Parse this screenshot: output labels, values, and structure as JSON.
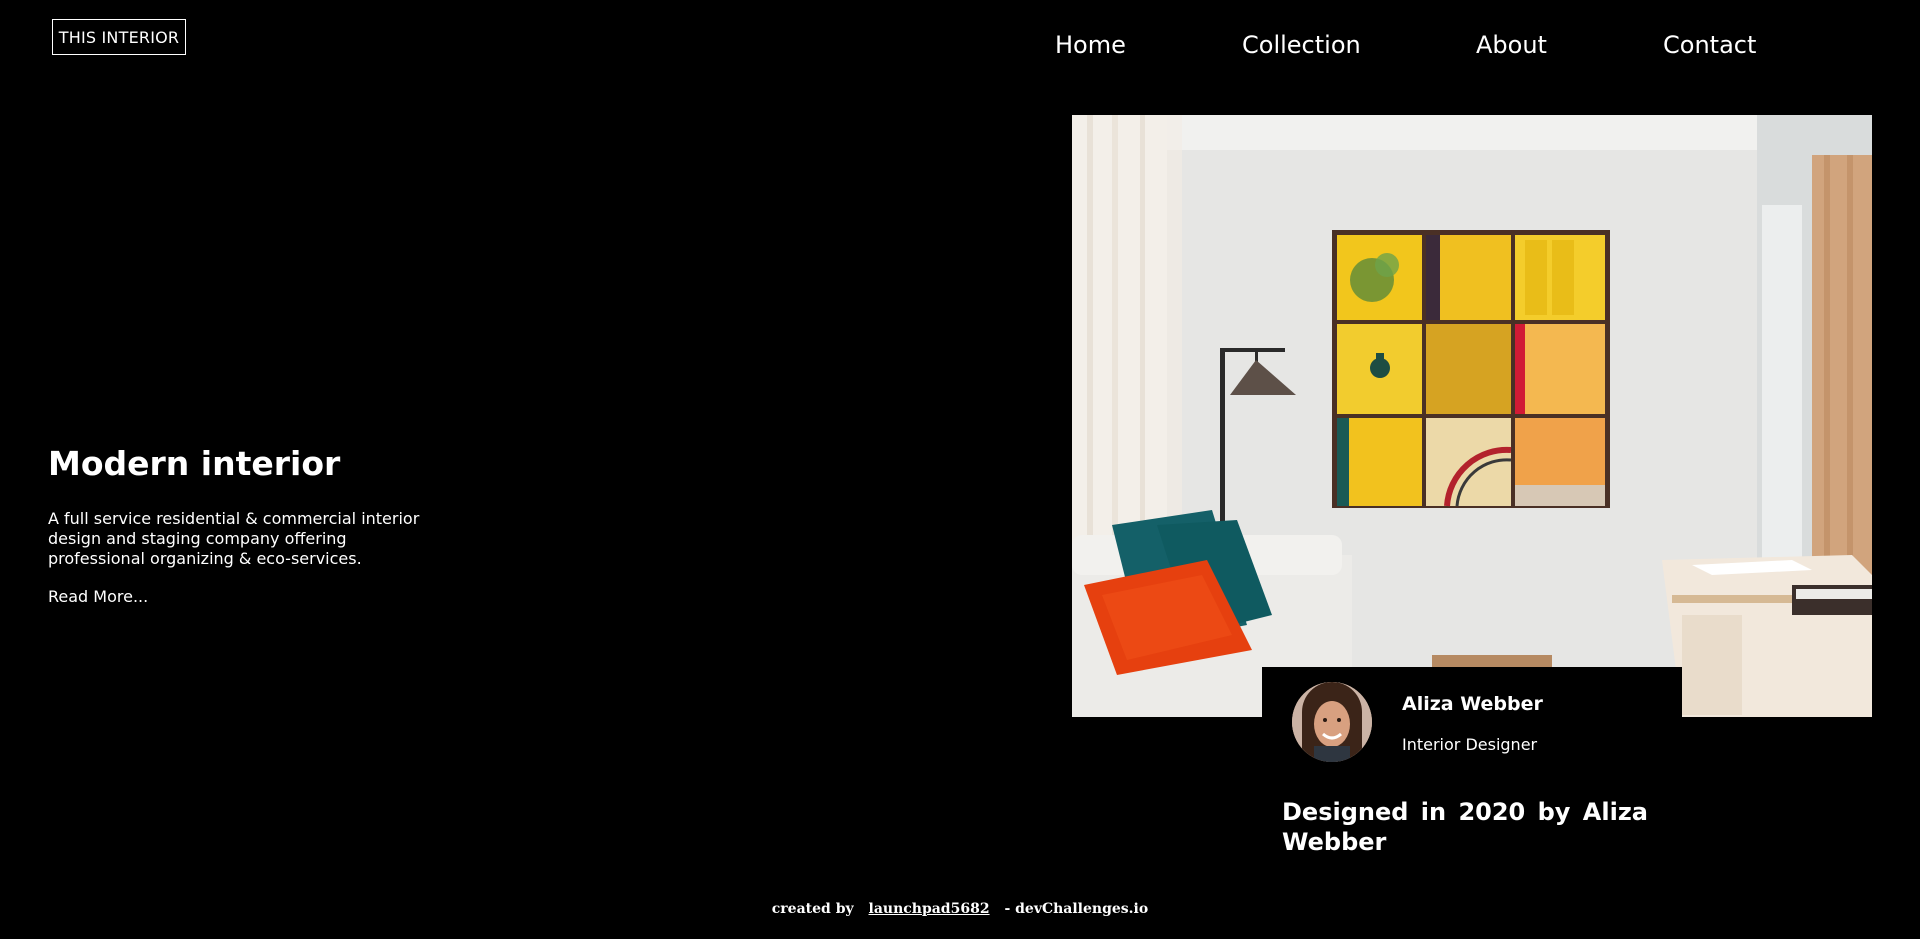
{
  "header": {
    "logo_text": "THIS INTERIOR",
    "nav": [
      {
        "label": "Home"
      },
      {
        "label": "Collection"
      },
      {
        "label": "About"
      },
      {
        "label": "Contact"
      }
    ]
  },
  "hero": {
    "title": "Modern interior",
    "description": "A full service residential & commercial interior design and staging company offering professional organizing & eco-services.",
    "read_more": "Read More..."
  },
  "designer": {
    "name": "Aliza Webber",
    "role": "Interior Designer",
    "designed_by": "Designed in 2020 by Aliza Webber"
  },
  "footer": {
    "prefix": "created by",
    "username": "launchpad5682",
    "suffix": "- devChallenges.io"
  },
  "colors": {
    "background": "#000000",
    "text": "#ffffff"
  }
}
